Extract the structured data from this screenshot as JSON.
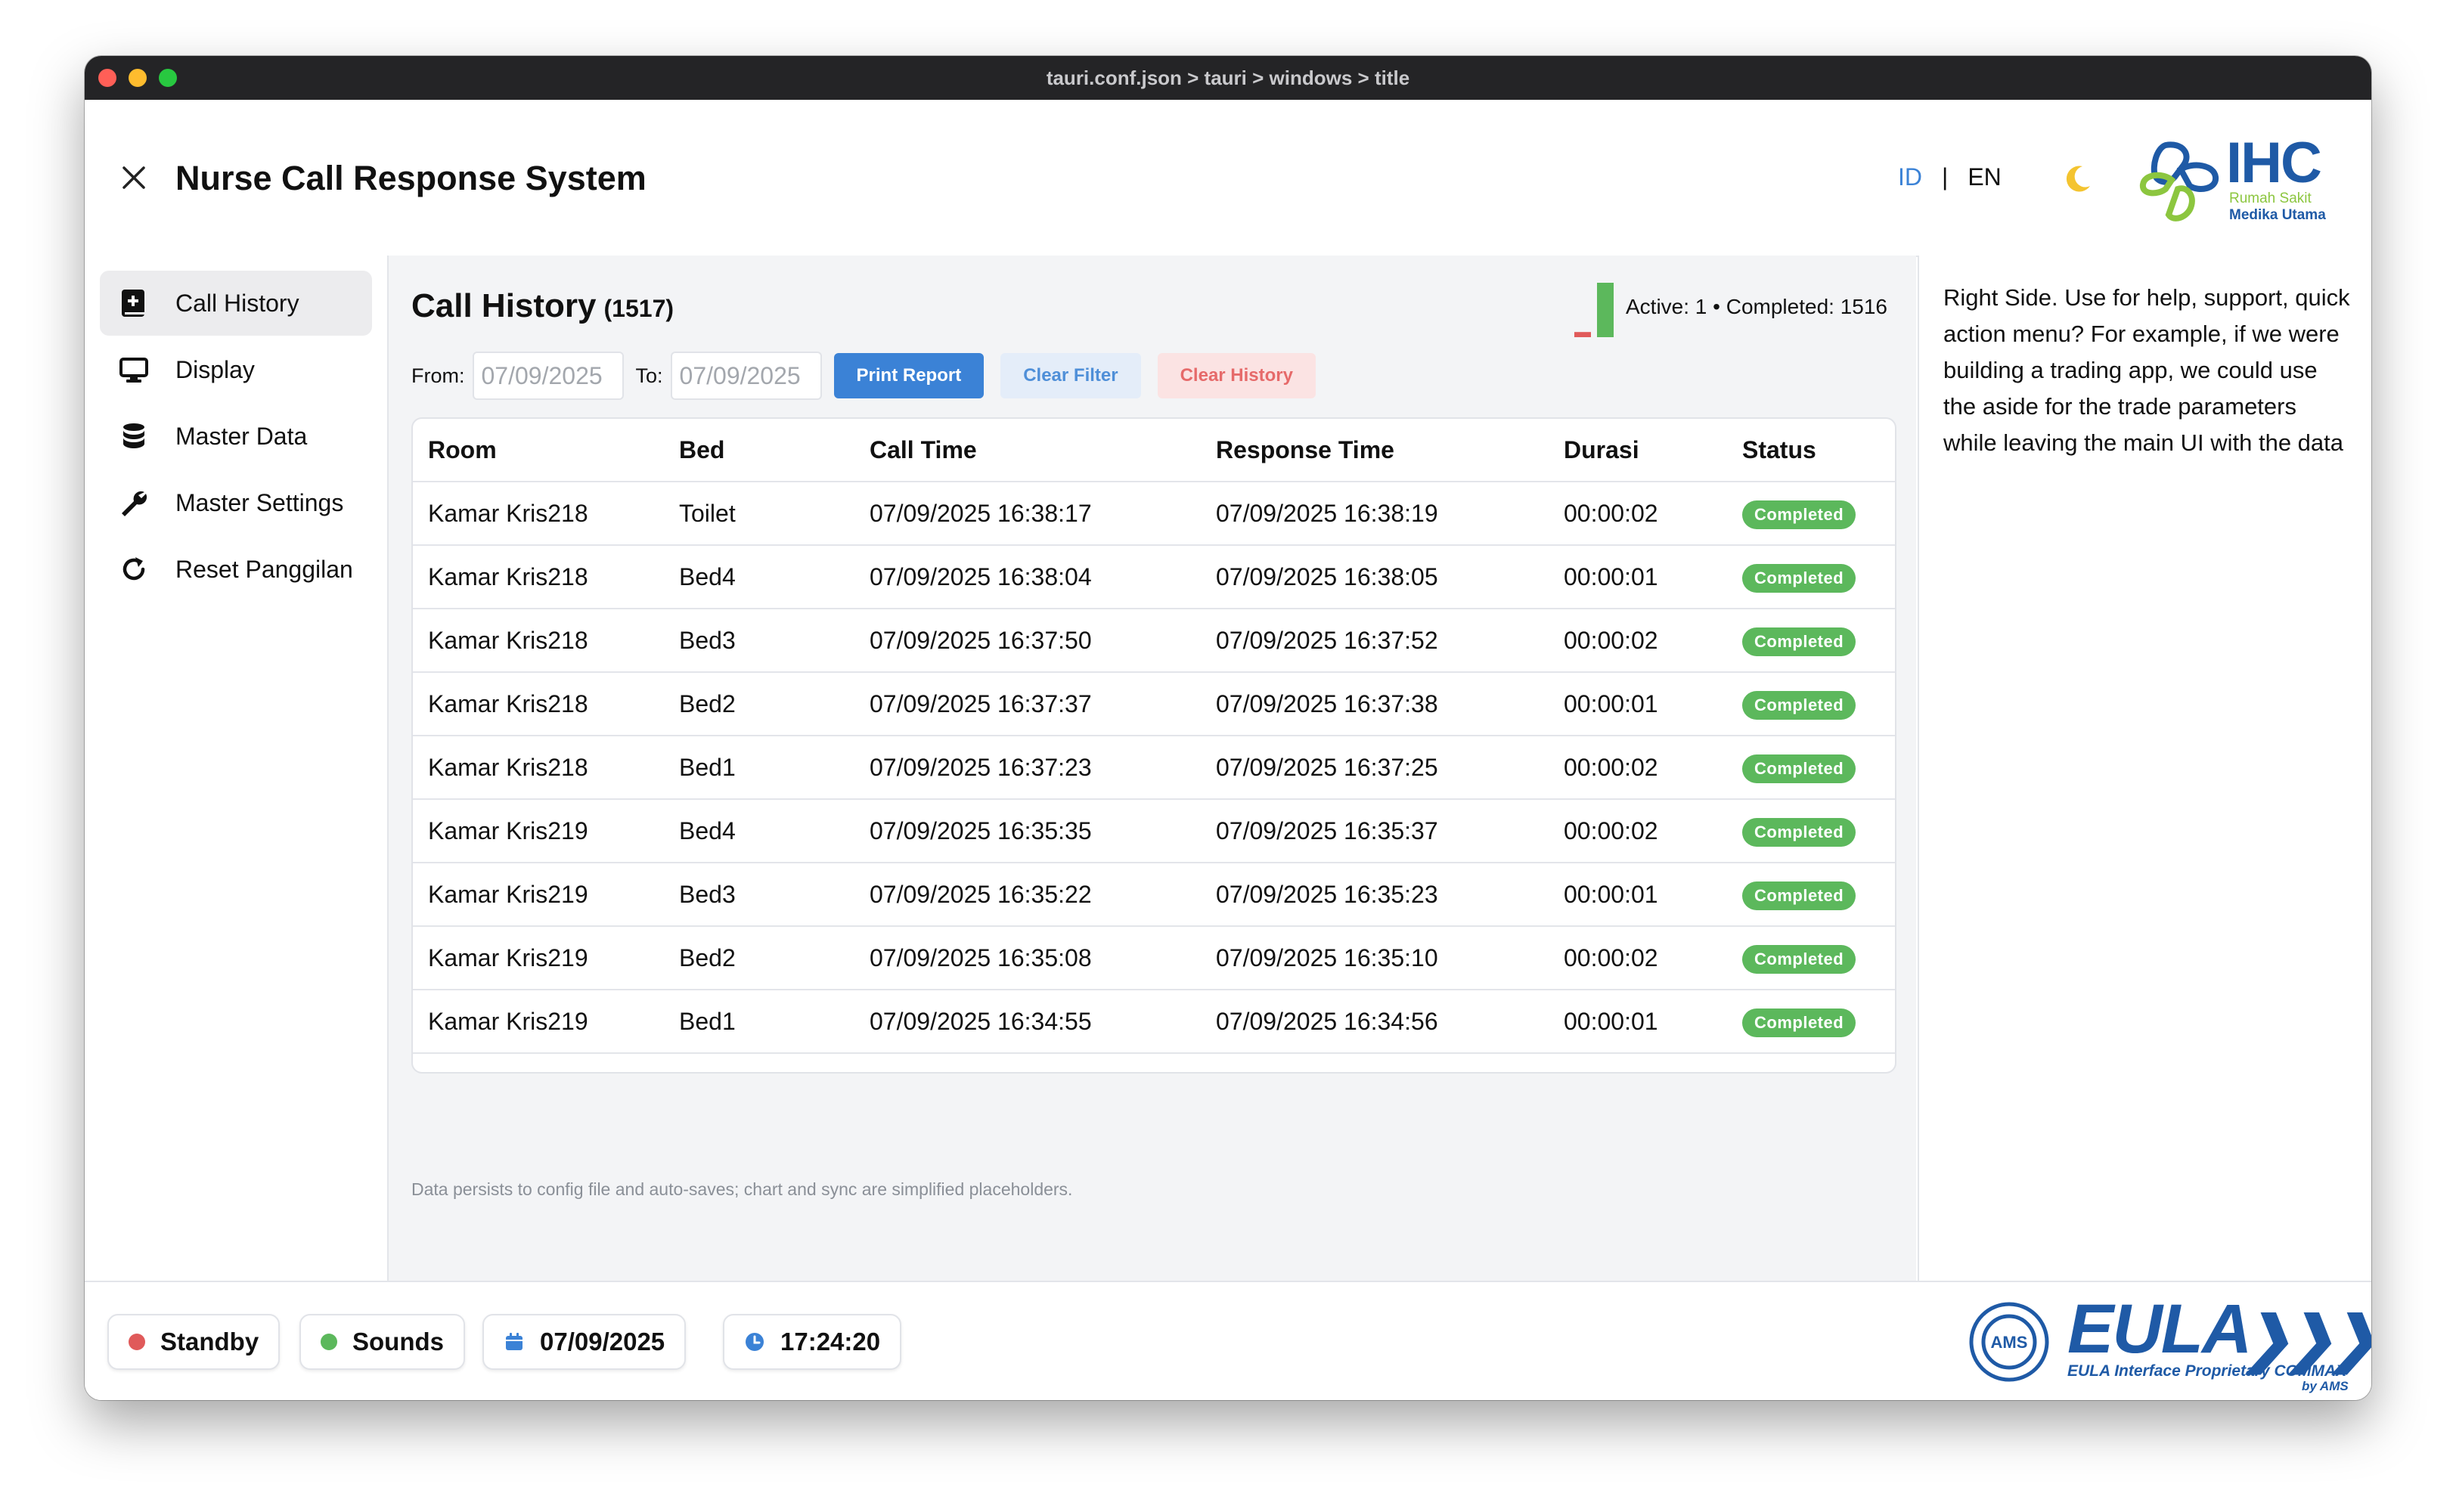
{
  "window": {
    "titlebar": "tauri.conf.json > tauri > windows > title"
  },
  "header": {
    "app_title": "Nurse Call Response System",
    "lang_id": "ID",
    "lang_sep": "|",
    "lang_en": "EN",
    "logo": {
      "brand": "IHC",
      "sub1": "Rumah Sakit",
      "sub2": "Medika Utama"
    }
  },
  "sidebar": {
    "items": [
      {
        "label": "Call History",
        "icon": "call-history-icon"
      },
      {
        "label": "Display",
        "icon": "monitor-icon"
      },
      {
        "label": "Master Data",
        "icon": "database-icon"
      },
      {
        "label": "Master Settings",
        "icon": "wrench-icon"
      },
      {
        "label": "Reset Panggilan",
        "icon": "refresh-icon"
      }
    ]
  },
  "main": {
    "title": "Call History",
    "count": "(1517)",
    "stats": "Active: 1 • Completed: 1516",
    "mini_chart": {
      "active": 1,
      "completed": 1516,
      "active_color": "#e05a5a",
      "completed_color": "#5cb85c"
    },
    "filter": {
      "from_label": "From:",
      "from_value": "07/09/2025",
      "to_label": "To:",
      "to_value": "07/09/2025",
      "print_label": "Print Report",
      "clear_filter_label": "Clear Filter",
      "clear_history_label": "Clear History"
    },
    "table": {
      "headers": [
        "Room",
        "Bed",
        "Call Time",
        "Response Time",
        "Durasi",
        "Status"
      ],
      "rows": [
        [
          "Kamar Kris218",
          "Toilet",
          "07/09/2025 16:38:17",
          "07/09/2025 16:38:19",
          "00:00:02",
          "Completed"
        ],
        [
          "Kamar Kris218",
          "Bed4",
          "07/09/2025 16:38:04",
          "07/09/2025 16:38:05",
          "00:00:01",
          "Completed"
        ],
        [
          "Kamar Kris218",
          "Bed3",
          "07/09/2025 16:37:50",
          "07/09/2025 16:37:52",
          "00:00:02",
          "Completed"
        ],
        [
          "Kamar Kris218",
          "Bed2",
          "07/09/2025 16:37:37",
          "07/09/2025 16:37:38",
          "00:00:01",
          "Completed"
        ],
        [
          "Kamar Kris218",
          "Bed1",
          "07/09/2025 16:37:23",
          "07/09/2025 16:37:25",
          "00:00:02",
          "Completed"
        ],
        [
          "Kamar Kris219",
          "Bed4",
          "07/09/2025 16:35:35",
          "07/09/2025 16:35:37",
          "00:00:02",
          "Completed"
        ],
        [
          "Kamar Kris219",
          "Bed3",
          "07/09/2025 16:35:22",
          "07/09/2025 16:35:23",
          "00:00:01",
          "Completed"
        ],
        [
          "Kamar Kris219",
          "Bed2",
          "07/09/2025 16:35:08",
          "07/09/2025 16:35:10",
          "00:00:02",
          "Completed"
        ],
        [
          "Kamar Kris219",
          "Bed1",
          "07/09/2025 16:34:55",
          "07/09/2025 16:34:56",
          "00:00:01",
          "Completed"
        ]
      ]
    },
    "footnote": "Data persists to config file and auto-saves; chart and sync are simplified placeholders."
  },
  "aside": {
    "text": "Right Side. Use for help, support, quick action menu? For example, if we were building a trading app, we could use the aside for the trade parameters while leaving the main UI with the data"
  },
  "footer": {
    "standby": "Standby",
    "sounds": "Sounds",
    "date": "07/09/2025",
    "time": "17:24:20",
    "eula_big": "EULA",
    "eula_line1": "EULA Interface Proprietary COMMAX",
    "eula_line2": "by AMS",
    "seal_text": "AMS"
  },
  "colors": {
    "accent": "#3b82d6",
    "success": "#5cb85c",
    "danger": "#e05a5a",
    "brand": "#1f5aa6"
  }
}
